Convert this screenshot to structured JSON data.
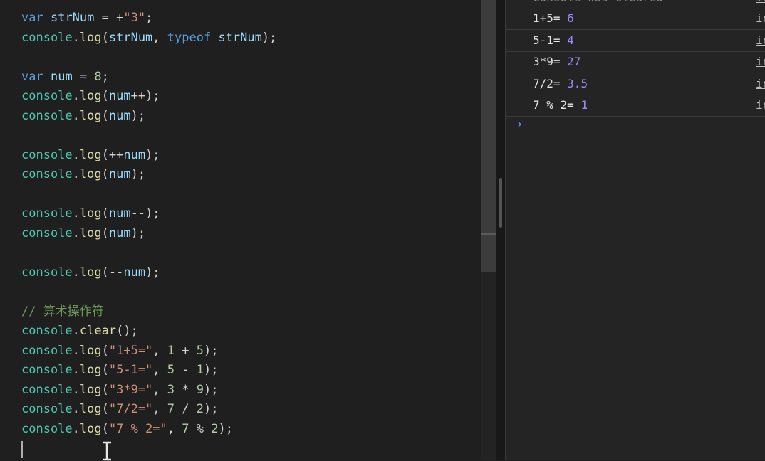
{
  "editor": {
    "lines": [
      [
        {
          "t": "var",
          "c": "kw"
        },
        {
          "t": " ",
          "c": "op"
        },
        {
          "t": "strNum",
          "c": "var"
        },
        {
          "t": " = +",
          "c": "op"
        },
        {
          "t": "\"3\"",
          "c": "str"
        },
        {
          "t": ";",
          "c": "op"
        }
      ],
      [
        {
          "t": "console",
          "c": "obj"
        },
        {
          "t": ".",
          "c": "op"
        },
        {
          "t": "log",
          "c": "fn"
        },
        {
          "t": "(",
          "c": "op"
        },
        {
          "t": "strNum",
          "c": "var"
        },
        {
          "t": ", ",
          "c": "op"
        },
        {
          "t": "typeof",
          "c": "kw"
        },
        {
          "t": " ",
          "c": "op"
        },
        {
          "t": "strNum",
          "c": "var"
        },
        {
          "t": ");",
          "c": "op"
        }
      ],
      [],
      [
        {
          "t": "var",
          "c": "kw"
        },
        {
          "t": " ",
          "c": "op"
        },
        {
          "t": "num",
          "c": "var"
        },
        {
          "t": " = ",
          "c": "op"
        },
        {
          "t": "8",
          "c": "num"
        },
        {
          "t": ";",
          "c": "op"
        }
      ],
      [
        {
          "t": "console",
          "c": "obj"
        },
        {
          "t": ".",
          "c": "op"
        },
        {
          "t": "log",
          "c": "fn"
        },
        {
          "t": "(",
          "c": "op"
        },
        {
          "t": "num",
          "c": "var"
        },
        {
          "t": "++);",
          "c": "op"
        }
      ],
      [
        {
          "t": "console",
          "c": "obj"
        },
        {
          "t": ".",
          "c": "op"
        },
        {
          "t": "log",
          "c": "fn"
        },
        {
          "t": "(",
          "c": "op"
        },
        {
          "t": "num",
          "c": "var"
        },
        {
          "t": ");",
          "c": "op"
        }
      ],
      [],
      [
        {
          "t": "console",
          "c": "obj"
        },
        {
          "t": ".",
          "c": "op"
        },
        {
          "t": "log",
          "c": "fn"
        },
        {
          "t": "(++",
          "c": "op"
        },
        {
          "t": "num",
          "c": "var"
        },
        {
          "t": ");",
          "c": "op"
        }
      ],
      [
        {
          "t": "console",
          "c": "obj"
        },
        {
          "t": ".",
          "c": "op"
        },
        {
          "t": "log",
          "c": "fn"
        },
        {
          "t": "(",
          "c": "op"
        },
        {
          "t": "num",
          "c": "var"
        },
        {
          "t": ");",
          "c": "op"
        }
      ],
      [],
      [
        {
          "t": "console",
          "c": "obj"
        },
        {
          "t": ".",
          "c": "op"
        },
        {
          "t": "log",
          "c": "fn"
        },
        {
          "t": "(",
          "c": "op"
        },
        {
          "t": "num",
          "c": "var"
        },
        {
          "t": "--);",
          "c": "op"
        }
      ],
      [
        {
          "t": "console",
          "c": "obj"
        },
        {
          "t": ".",
          "c": "op"
        },
        {
          "t": "log",
          "c": "fn"
        },
        {
          "t": "(",
          "c": "op"
        },
        {
          "t": "num",
          "c": "var"
        },
        {
          "t": ");",
          "c": "op"
        }
      ],
      [],
      [
        {
          "t": "console",
          "c": "obj"
        },
        {
          "t": ".",
          "c": "op"
        },
        {
          "t": "log",
          "c": "fn"
        },
        {
          "t": "(--",
          "c": "op"
        },
        {
          "t": "num",
          "c": "var"
        },
        {
          "t": ");",
          "c": "op"
        }
      ],
      [],
      [
        {
          "t": "// 算术操作符",
          "c": "cmt"
        }
      ],
      [
        {
          "t": "console",
          "c": "obj"
        },
        {
          "t": ".",
          "c": "op"
        },
        {
          "t": "clear",
          "c": "fn"
        },
        {
          "t": "();",
          "c": "op"
        }
      ],
      [
        {
          "t": "console",
          "c": "obj"
        },
        {
          "t": ".",
          "c": "op"
        },
        {
          "t": "log",
          "c": "fn"
        },
        {
          "t": "(",
          "c": "op"
        },
        {
          "t": "\"1+5=\"",
          "c": "str"
        },
        {
          "t": ", ",
          "c": "op"
        },
        {
          "t": "1",
          "c": "num"
        },
        {
          "t": " + ",
          "c": "op"
        },
        {
          "t": "5",
          "c": "num"
        },
        {
          "t": ");",
          "c": "op"
        }
      ],
      [
        {
          "t": "console",
          "c": "obj"
        },
        {
          "t": ".",
          "c": "op"
        },
        {
          "t": "log",
          "c": "fn"
        },
        {
          "t": "(",
          "c": "op"
        },
        {
          "t": "\"5-1=\"",
          "c": "str"
        },
        {
          "t": ", ",
          "c": "op"
        },
        {
          "t": "5",
          "c": "num"
        },
        {
          "t": " - ",
          "c": "op"
        },
        {
          "t": "1",
          "c": "num"
        },
        {
          "t": ");",
          "c": "op"
        }
      ],
      [
        {
          "t": "console",
          "c": "obj"
        },
        {
          "t": ".",
          "c": "op"
        },
        {
          "t": "log",
          "c": "fn"
        },
        {
          "t": "(",
          "c": "op"
        },
        {
          "t": "\"3*9=\"",
          "c": "str"
        },
        {
          "t": ", ",
          "c": "op"
        },
        {
          "t": "3",
          "c": "num"
        },
        {
          "t": " * ",
          "c": "op"
        },
        {
          "t": "9",
          "c": "num"
        },
        {
          "t": ");",
          "c": "op"
        }
      ],
      [
        {
          "t": "console",
          "c": "obj"
        },
        {
          "t": ".",
          "c": "op"
        },
        {
          "t": "log",
          "c": "fn"
        },
        {
          "t": "(",
          "c": "op"
        },
        {
          "t": "\"7/2=\"",
          "c": "str"
        },
        {
          "t": ", ",
          "c": "op"
        },
        {
          "t": "7",
          "c": "num"
        },
        {
          "t": " / ",
          "c": "op"
        },
        {
          "t": "2",
          "c": "num"
        },
        {
          "t": ");",
          "c": "op"
        }
      ],
      [
        {
          "t": "console",
          "c": "obj"
        },
        {
          "t": ".",
          "c": "op"
        },
        {
          "t": "log",
          "c": "fn"
        },
        {
          "t": "(",
          "c": "op"
        },
        {
          "t": "\"7 % 2=\"",
          "c": "str"
        },
        {
          "t": ", ",
          "c": "op"
        },
        {
          "t": "7",
          "c": "num"
        },
        {
          "t": " % ",
          "c": "op"
        },
        {
          "t": "2",
          "c": "num"
        },
        {
          "t": ");",
          "c": "op"
        }
      ]
    ]
  },
  "console": {
    "cleared_text": "Console was cleared",
    "cleared_source": "in",
    "entries": [
      {
        "label": "1+5= ",
        "value": "6",
        "source": "in"
      },
      {
        "label": "5-1= ",
        "value": "4",
        "source": "in"
      },
      {
        "label": "3*9= ",
        "value": "27",
        "source": "in"
      },
      {
        "label": "7/2= ",
        "value": "3.5",
        "source": "in"
      },
      {
        "label": "7 % 2= ",
        "value": "1",
        "source": "in"
      }
    ],
    "prompt": "›"
  }
}
